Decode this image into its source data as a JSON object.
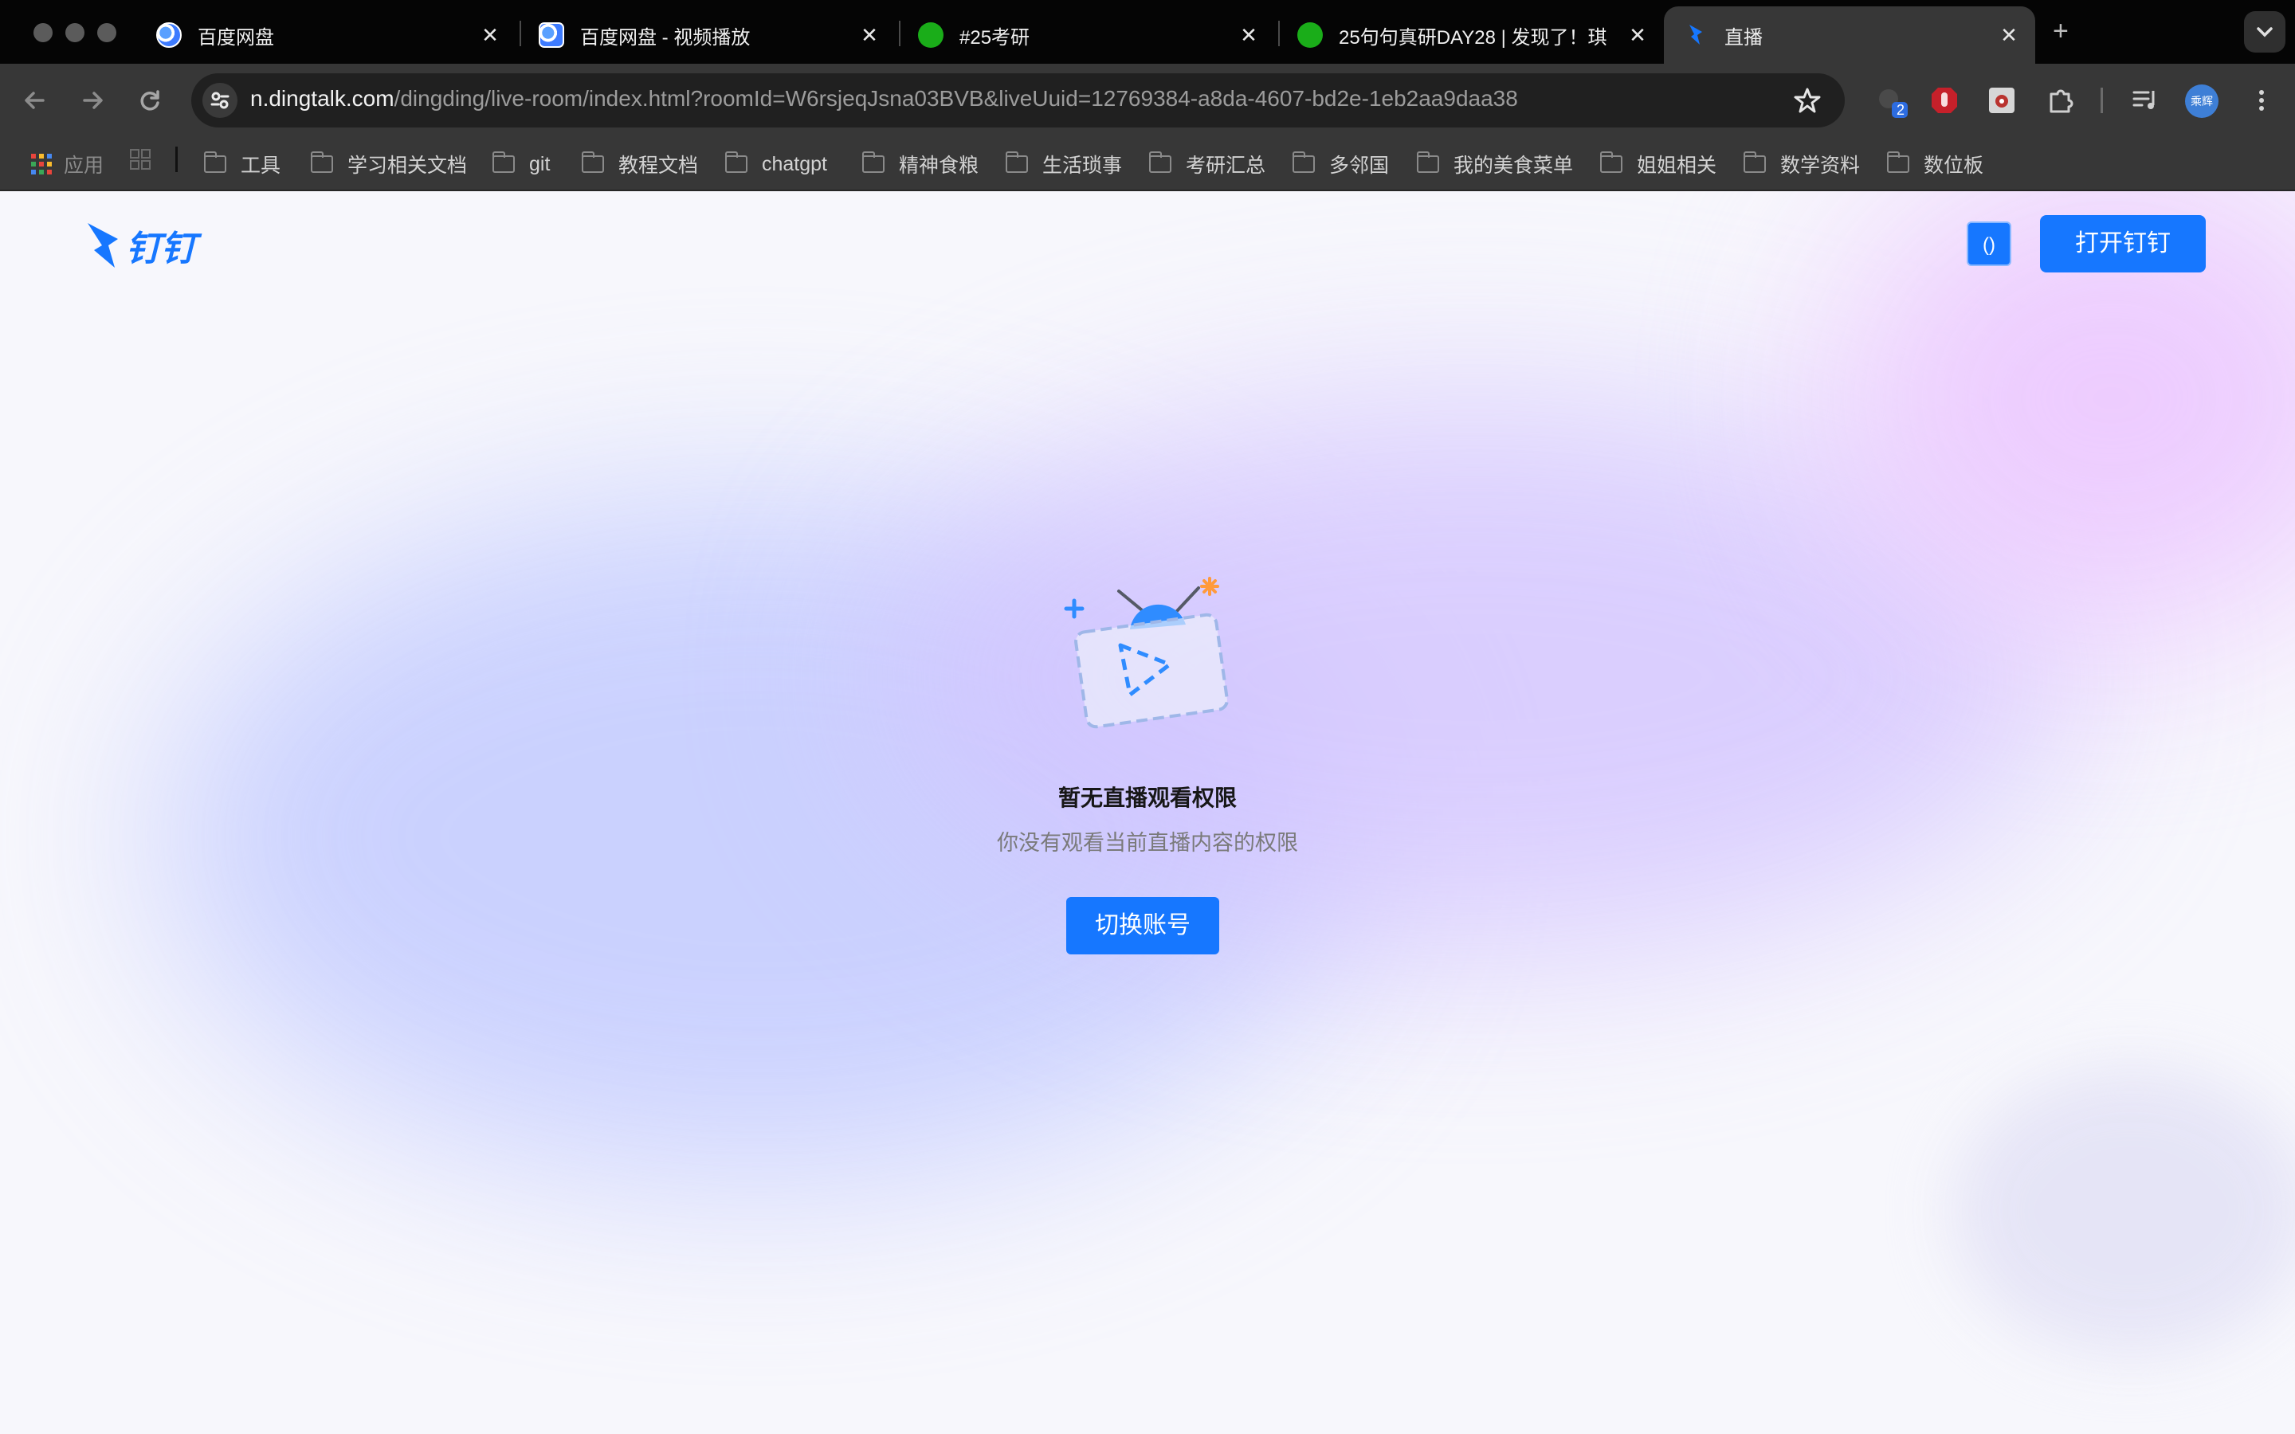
{
  "browser": {
    "tabs": [
      {
        "title": "百度网盘",
        "favicon": "baidu-netdisk-icon"
      },
      {
        "title": "百度网盘 - 视频播放",
        "favicon": "baidu-netdisk-icon"
      },
      {
        "title": "#25考研",
        "favicon": "wechat-icon"
      },
      {
        "title": "25句句真研DAY28 | 发现了！琪",
        "favicon": "wechat-icon"
      },
      {
        "title": "直播",
        "favicon": "dingtalk-icon",
        "active": true
      }
    ],
    "new_tab": "+",
    "close_glyph": "✕",
    "url": {
      "host": "n.dingtalk.com",
      "path": "/dingding/live-room/index.html?roomId=W6rsjeqJsna03BVB&liveUuid=12769384-a8da-4607-bd2e-1eb2aa9daa38"
    },
    "extension_badge": "2",
    "profile_label": "乘辉",
    "bookmarks": [
      "应用",
      "工具",
      "学习相关文档",
      "git",
      "教程文档",
      "chatgpt",
      "精神食粮",
      "生活琐事",
      "考研汇总",
      "多邻国",
      "我的美食菜单",
      "姐姐相关",
      "数学资料",
      "数位板"
    ]
  },
  "page": {
    "logo_text": "钉钉",
    "small_button": "()",
    "open_button": "打开钉钉",
    "message_title": "暂无直播观看权限",
    "message_subtitle": "你没有观看当前直播内容的权限",
    "switch_button": "切换账号"
  },
  "colors": {
    "accent": "#1677ff",
    "illus_orange": "#ff9a3c"
  }
}
